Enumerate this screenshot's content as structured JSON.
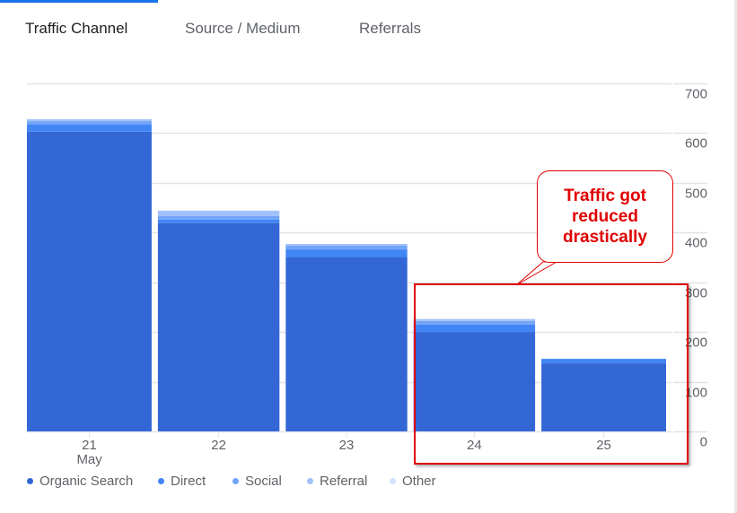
{
  "tabs": [
    {
      "label": "Traffic Channel",
      "active": true
    },
    {
      "label": "Source / Medium",
      "active": false
    },
    {
      "label": "Referrals",
      "active": false
    }
  ],
  "annotation": {
    "callout_text": "Traffic got reduced drastically",
    "color": "#e00000",
    "highlighted_categories": [
      "24",
      "25"
    ]
  },
  "chart_data": {
    "type": "bar",
    "stacked": true,
    "title": "",
    "xlabel": "",
    "ylabel": "",
    "categories": [
      "21",
      "22",
      "23",
      "24",
      "25"
    ],
    "category_sublabels": [
      "May",
      "",
      "",
      "",
      ""
    ],
    "ylim": [
      0,
      700
    ],
    "yticks": [
      0,
      100,
      200,
      300,
      400,
      500,
      600,
      700
    ],
    "ytick_labels": [
      "0",
      "100",
      "200",
      "300",
      "400",
      "500",
      "600",
      "700"
    ],
    "y_axis_side": "right",
    "grid": true,
    "legend_position": "bottom-left",
    "series": [
      {
        "name": "Organic Search",
        "color": "#3367d6",
        "values": [
          603,
          419,
          350,
          200,
          137
        ]
      },
      {
        "name": "Direct",
        "color": "#4285f4",
        "values": [
          14,
          7,
          16,
          15,
          9
        ]
      },
      {
        "name": "Social",
        "color": "#72a4f8",
        "values": [
          7,
          7,
          8,
          7,
          0
        ]
      },
      {
        "name": "Referral",
        "color": "#a1c2fa",
        "values": [
          4,
          11,
          3,
          4,
          0
        ]
      },
      {
        "name": "Other",
        "color": "#d2e3fc",
        "values": [
          0,
          0,
          0,
          0,
          0
        ]
      }
    ]
  }
}
